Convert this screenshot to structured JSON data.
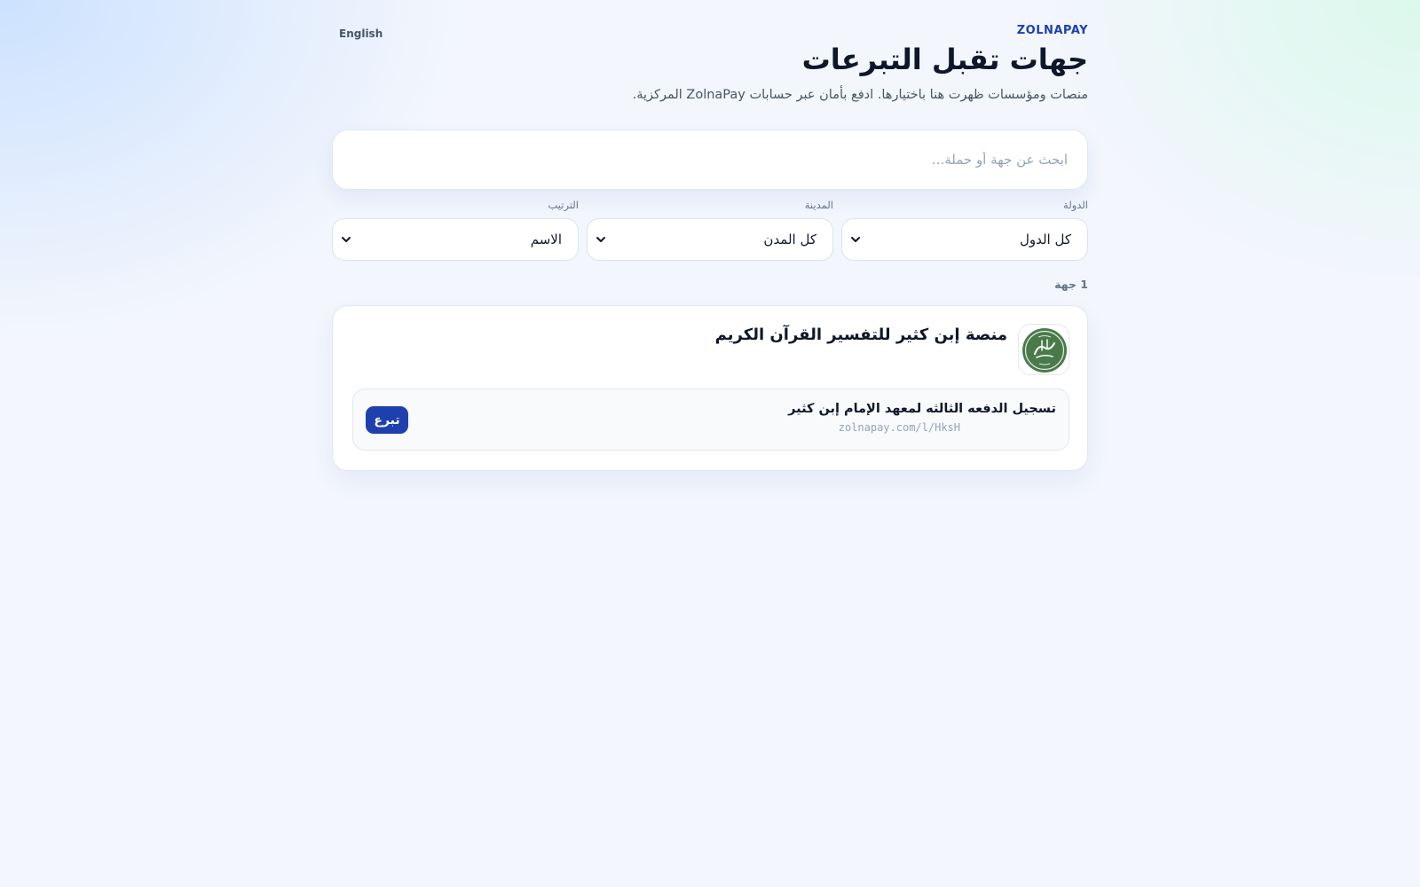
{
  "header": {
    "language_toggle": "English",
    "brand": "ZOLNAPAY",
    "title": "جهات تقبل التبرعات",
    "subtitle": "منصات ومؤسسات ظهرت هنا باختيارها. ادفع بأمان عبر حسابات ZolnaPay المركزية."
  },
  "search": {
    "placeholder": "ابحث عن جهة أو حملة...",
    "value": ""
  },
  "filters": {
    "country": {
      "label": "الدولة",
      "value": "كل الدول"
    },
    "city": {
      "label": "المدينة",
      "value": "كل المدن"
    },
    "sort": {
      "label": "الترتيب",
      "value": "الاسم"
    }
  },
  "results": {
    "count_label": "1 جهة",
    "organizations": [
      {
        "name": "منصة إبن كثير للتفسير القرآن الكريم",
        "logo_icon": "ibn-kathir-seal-icon",
        "logo_color": "#4a7a4a",
        "campaigns": [
          {
            "title": "تسجيل الدفعه الثالثه لمعهد الإمام إبن كثير",
            "link": "zolnapay.com/l/HksH",
            "donate_label": "تبرع"
          }
        ]
      }
    ]
  },
  "colors": {
    "accent": "#1e40af",
    "background": "#f3f6fd"
  }
}
